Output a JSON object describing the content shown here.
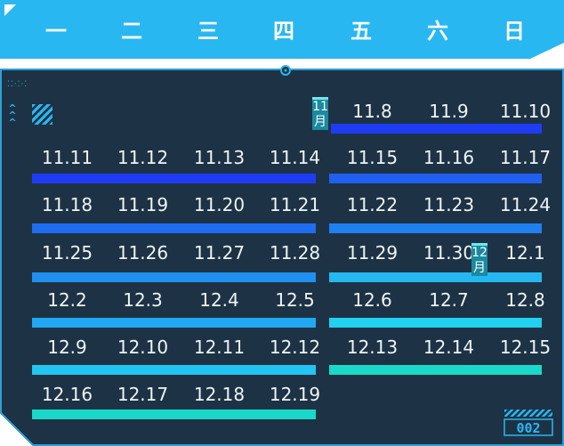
{
  "colors": {
    "header": "#29b7f2",
    "panel": "#1d3345",
    "border": "#2a9fd6",
    "text": "#eef4f8",
    "month_tag": "#1a8aa0"
  },
  "weekdays": [
    "一",
    "二",
    "三",
    "四",
    "五",
    "六",
    "日"
  ],
  "weeks": [
    {
      "days": [
        "",
        "",
        "",
        "",
        "11.8",
        "11.9",
        "11.10"
      ],
      "bar_colors": [
        "",
        "#1f3cf5"
      ]
    },
    {
      "days": [
        "11.11",
        "11.12",
        "11.13",
        "11.14",
        "11.15",
        "11.16",
        "11.17"
      ],
      "bar_colors": [
        "#1f3cf5",
        "#1f60f0"
      ]
    },
    {
      "days": [
        "11.18",
        "11.19",
        "11.20",
        "11.21",
        "11.22",
        "11.23",
        "11.24"
      ],
      "bar_colors": [
        "#1f6df0",
        "#1f80f0"
      ]
    },
    {
      "days": [
        "11.25",
        "11.26",
        "11.27",
        "11.28",
        "11.29",
        "11.30",
        "12.1"
      ],
      "bar_colors": [
        "#1f90f0",
        "#25b8f0"
      ]
    },
    {
      "days": [
        "12.2",
        "12.3",
        "12.4",
        "12.5",
        "12.6",
        "12.7",
        "12.8"
      ],
      "bar_colors": [
        "#22a8f2",
        "#22d0f0"
      ]
    },
    {
      "days": [
        "12.9",
        "12.10",
        "12.11",
        "12.12",
        "12.13",
        "12.14",
        "12.15"
      ],
      "bar_colors": [
        "#22c5f2",
        "#1ad9c8"
      ]
    },
    {
      "days": [
        "12.16",
        "12.17",
        "12.18",
        "12.19",
        "",
        "",
        ""
      ],
      "bar_colors": [
        "#1ad8c8",
        ""
      ]
    }
  ],
  "month_tags": [
    {
      "text": "11月",
      "week": 0,
      "after_col": 3
    },
    {
      "text": "12月",
      "week": 3,
      "after_col": 5
    }
  ],
  "footer_code": "002"
}
